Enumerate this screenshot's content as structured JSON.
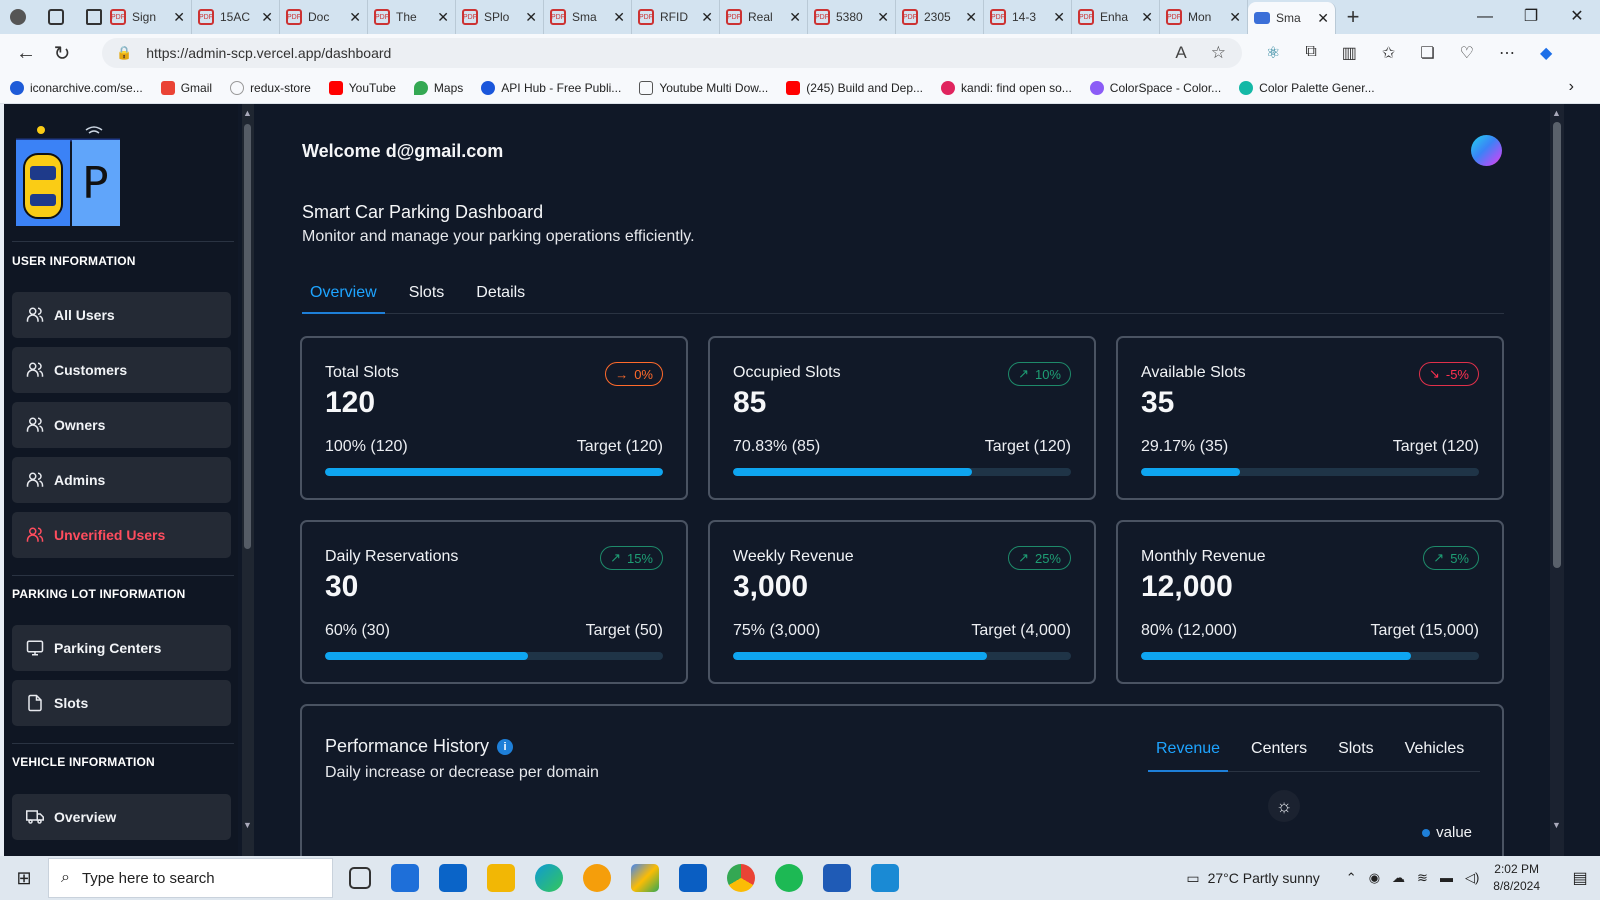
{
  "browser": {
    "tabs": [
      {
        "label": "Sign",
        "icon": "pdf-icon"
      },
      {
        "label": "15AC",
        "icon": "pdf-icon"
      },
      {
        "label": "Doc",
        "icon": "pdf-icon"
      },
      {
        "label": "The",
        "icon": "pdf-icon"
      },
      {
        "label": "SPlo",
        "icon": "pdf-icon"
      },
      {
        "label": "Sma",
        "icon": "pdf-icon"
      },
      {
        "label": "RFID",
        "icon": "pdf-icon"
      },
      {
        "label": "Real",
        "icon": "pdf-icon"
      },
      {
        "label": "5380",
        "icon": "pdf-icon"
      },
      {
        "label": "2305",
        "icon": "pdf-icon"
      },
      {
        "label": "14-3",
        "icon": "pdf-icon"
      },
      {
        "label": "Enha",
        "icon": "pdf-icon"
      },
      {
        "label": "Mon",
        "icon": "pdf-icon"
      },
      {
        "label": "Sma",
        "icon": "site-icon",
        "active": true
      }
    ],
    "url": "https://admin-scp.vercel.app/dashboard",
    "bookmarks": [
      {
        "label": "iconarchive.com/se...",
        "color": "#1e5bd8"
      },
      {
        "label": "Gmail",
        "color": "#ea4335"
      },
      {
        "label": "redux-store",
        "color": "#ffffff"
      },
      {
        "label": "YouTube",
        "color": "#ff0000"
      },
      {
        "label": "Maps",
        "color": "#34a853"
      },
      {
        "label": "API Hub - Free Publi...",
        "color": "#1a56db"
      },
      {
        "label": "Youtube Multi Dow...",
        "color": "#ffffff"
      },
      {
        "label": "(245) Build and Dep...",
        "color": "#ff0000"
      },
      {
        "label": "kandi: find open so...",
        "color": "#e0245e"
      },
      {
        "label": "ColorSpace - Color...",
        "color": "#8b5cf6"
      },
      {
        "label": "Color Palette Gener...",
        "color": "#14b8a6"
      }
    ]
  },
  "sidebar": {
    "sections": [
      {
        "title": "USER INFORMATION"
      },
      {
        "title": "PARKING LOT INFORMATION"
      },
      {
        "title": "VEHICLE INFORMATION"
      }
    ],
    "items": [
      {
        "label": "All Users",
        "icon": "users-icon"
      },
      {
        "label": "Customers",
        "icon": "users-icon"
      },
      {
        "label": "Owners",
        "icon": "users-icon"
      },
      {
        "label": "Admins",
        "icon": "users-icon"
      },
      {
        "label": "Unverified Users",
        "icon": "users-icon"
      },
      {
        "label": "Parking Centers",
        "icon": "monitor-icon"
      },
      {
        "label": "Slots",
        "icon": "file-icon"
      },
      {
        "label": "Overview",
        "icon": "truck-icon"
      }
    ]
  },
  "header": {
    "welcome": "Welcome d@gmail.com",
    "title": "Smart Car Parking Dashboard",
    "subtitle": "Monitor and manage your parking operations efficiently."
  },
  "tabs": [
    "Overview",
    "Slots",
    "Details"
  ],
  "cards": [
    {
      "title": "Total Slots",
      "value": "120",
      "badge": "0%",
      "badge_arrow": "→",
      "progress_label": "100% (120)",
      "target": "Target (120)",
      "progress": 1.0
    },
    {
      "title": "Occupied Slots",
      "value": "85",
      "badge": "10%",
      "badge_arrow": "↗",
      "progress_label": "70.83% (85)",
      "target": "Target (120)",
      "progress": 0.7083
    },
    {
      "title": "Available Slots",
      "value": "35",
      "badge": "-5%",
      "badge_arrow": "↘",
      "progress_label": "29.17% (35)",
      "target": "Target (120)",
      "progress": 0.2917
    },
    {
      "title": "Daily Reservations",
      "value": "30",
      "badge": "15%",
      "badge_arrow": "↗",
      "progress_label": "60% (30)",
      "target": "Target (50)",
      "progress": 0.6
    },
    {
      "title": "Weekly Revenue",
      "value": "3,000",
      "badge": "25%",
      "badge_arrow": "↗",
      "progress_label": "75% (3,000)",
      "target": "Target (4,000)",
      "progress": 0.75
    },
    {
      "title": "Monthly Revenue",
      "value": "12,000",
      "badge": "5%",
      "badge_arrow": "↗",
      "progress_label": "80% (12,000)",
      "target": "Target (15,000)",
      "progress": 0.8
    }
  ],
  "performance": {
    "title": "Performance History",
    "subtitle": "Daily increase or decrease per domain",
    "tabs": [
      "Revenue",
      "Centers",
      "Slots",
      "Vehicles"
    ],
    "legend": "value"
  },
  "taskbar": {
    "search_placeholder": "Type here to search",
    "weather": "27°C  Partly sunny",
    "time": "2:02 PM",
    "date": "8/8/2024"
  }
}
